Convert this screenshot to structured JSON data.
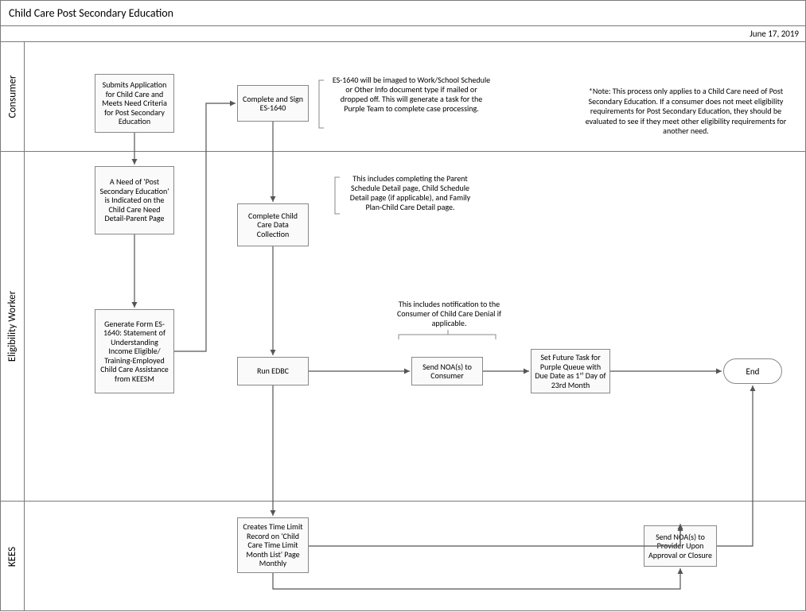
{
  "title": "Child Care Post Secondary Education",
  "date": "June 17, 2019",
  "lanes": {
    "consumer": "Consumer",
    "worker": "Eligibility Worker",
    "kees": "KEES"
  },
  "boxes": {
    "submit": "Submits Application for Child Care and Meets Need Criteria for Post Secondary Education",
    "sign1640": "Complete and Sign ES-1640",
    "needIndicated": "A Need of 'Post Secondary Education' is Indicated on the Child Care Need Detail-Parent Page",
    "generate1640": "Generate Form ES-1640: Statement of Understanding Income Eligible/ Training-Employed Child Care Assistance from KEESM",
    "completeData": "Complete Child Care Data Collection",
    "runEdbc": "Run EDBC",
    "sendNoaConsumer": "Send NOA(s) to Consumer",
    "setFutureTask": "Set Future Task for Purple Queue with Due Date as 1ˢᵗ Day of 23rd Month",
    "createsTimeLimit": "Creates Time Limit Record on 'Child Care Time Limit Month List' Page Monthly",
    "sendNoaProvider": "Send NOA(s) to Provider Upon Approval or Closure",
    "end": "End"
  },
  "annotations": {
    "es1640Imaged": "ES-1640 will be imaged to Work/School Schedule or Other Info document type if mailed or dropped off. This will generate a task for the Purple Team to complete case processing.",
    "parentSchedule": "This includes completing the Parent Schedule Detail page, Child Schedule Detail page (if applicable), and Family Plan-Child Care Detail page.",
    "denialNotification": "This includes notification to the Consumer of Child Care Denial if applicable.",
    "note": "*Note: This process only applies to a Child Care need of Post Secondary Education. If a consumer does not meet eligibility requirements for Post Secondary Education, they should be evaluated to see if they meet other eligibility requirements for another need."
  }
}
